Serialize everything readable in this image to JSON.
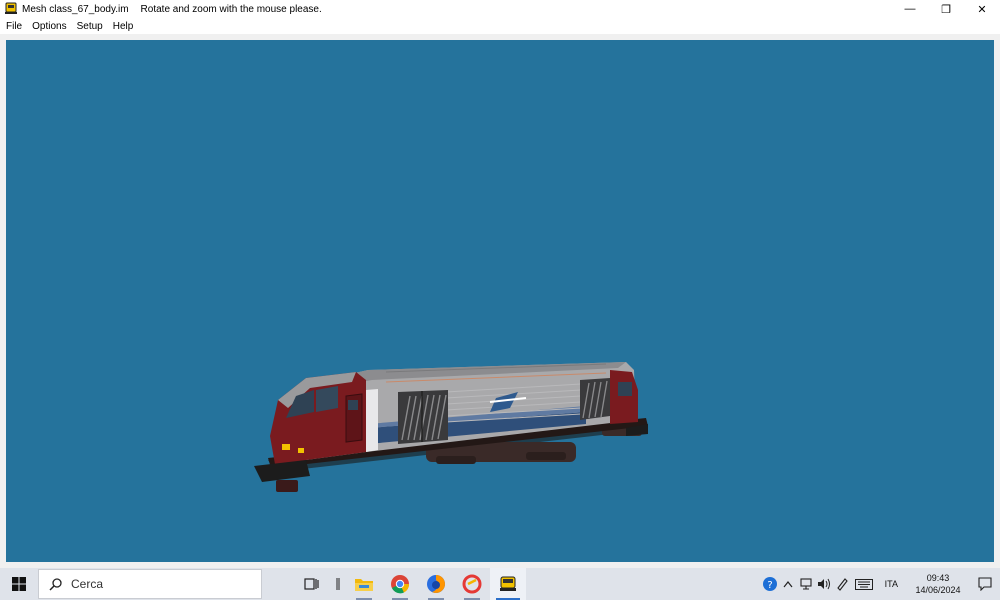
{
  "window": {
    "title": "Mesh class_67_body.im",
    "hint": "Rotate and zoom with the mouse please.",
    "controls": {
      "minimize": "—",
      "restore": "❐",
      "close": "✕"
    }
  },
  "menu": {
    "items": [
      {
        "id": "file",
        "label": "File"
      },
      {
        "id": "options",
        "label": "Options"
      },
      {
        "id": "setup",
        "label": "Setup"
      },
      {
        "id": "help",
        "label": "Help"
      }
    ]
  },
  "viewport": {
    "background": "#25739c",
    "model": "class_67_locomotive"
  },
  "taskbar": {
    "search_placeholder": "Cerca",
    "apps": [
      "task-view-icon",
      "separator-icon",
      "file-explorer-icon",
      "chrome-icon",
      "firefox-icon",
      "ccleaner-icon",
      "mesh-viewer-icon"
    ],
    "tray": {
      "language": "ITA",
      "time": "09:43",
      "date": "14/06/2024"
    }
  }
}
